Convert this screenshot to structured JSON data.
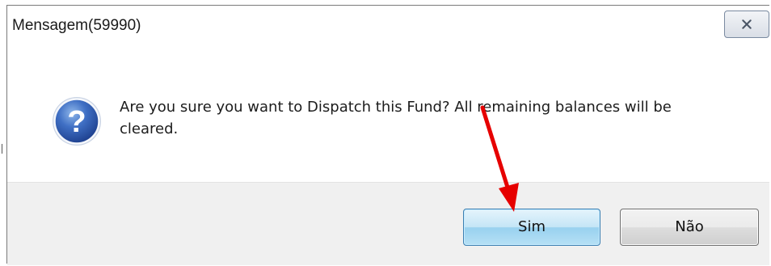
{
  "window": {
    "title": "Mensagem(59990)",
    "close_icon": "close-icon"
  },
  "message": {
    "icon": "question-icon",
    "text": "Are you sure you want to Dispatch this Fund? All remaining balances will be cleared."
  },
  "buttons": {
    "yes_label": "Sim",
    "no_label": "Não"
  },
  "annotation": {
    "arrow_color": "#e60000"
  },
  "colors": {
    "dialog_border": "#7a7a7a",
    "footer_bg": "#f0f0f0",
    "yes_button_border": "#3c7fb1"
  }
}
